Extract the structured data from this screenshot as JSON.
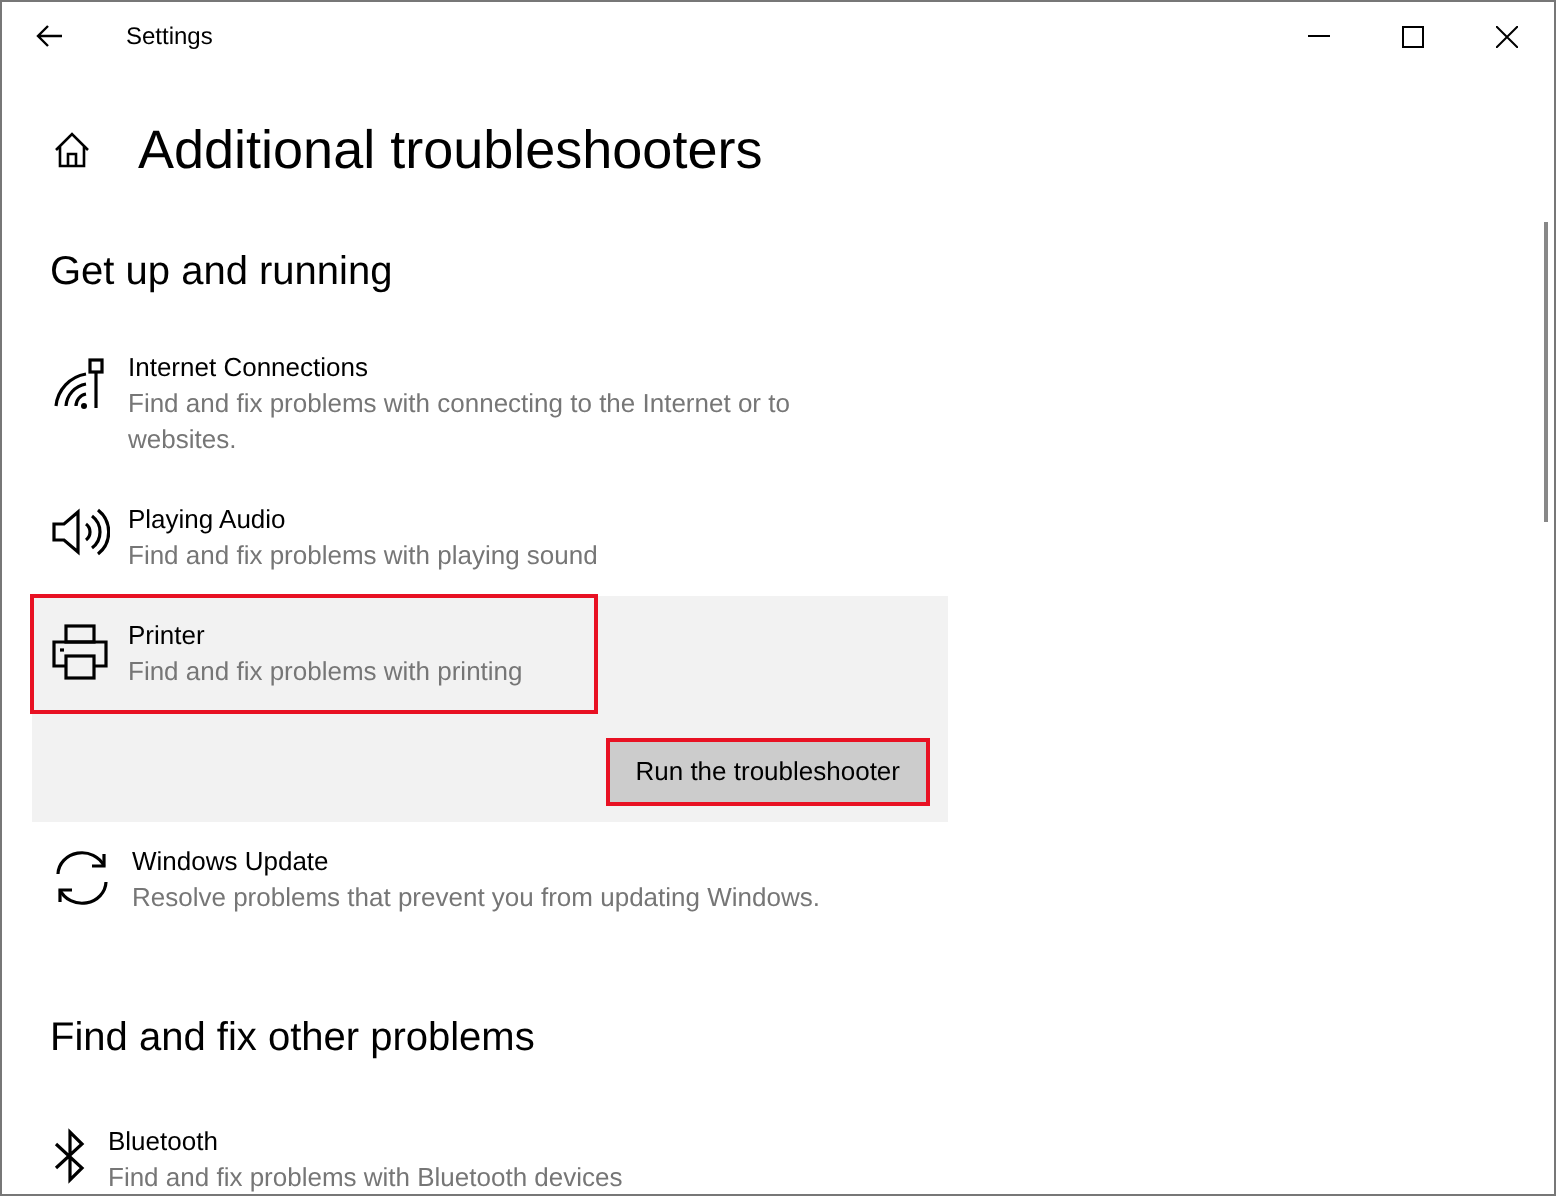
{
  "window": {
    "title": "Settings"
  },
  "page": {
    "title": "Additional troubleshooters"
  },
  "sections": [
    {
      "heading": "Get up and running",
      "items": [
        {
          "kind": "internet",
          "title": "Internet Connections",
          "description": "Find and fix problems with connecting to the Internet or to websites.",
          "selected": false,
          "highlighted": false
        },
        {
          "kind": "audio",
          "title": "Playing Audio",
          "description": "Find and fix problems with playing sound",
          "selected": false,
          "highlighted": false
        },
        {
          "kind": "printer",
          "title": "Printer",
          "description": "Find and fix problems with printing",
          "selected": true,
          "highlighted": true,
          "button": {
            "label": "Run the troubleshooter",
            "highlighted": true
          }
        },
        {
          "kind": "update",
          "title": "Windows Update",
          "description": "Resolve problems that prevent you from updating Windows.",
          "selected": false,
          "highlighted": false
        }
      ]
    },
    {
      "heading": "Find and fix other problems",
      "items": [
        {
          "kind": "bluetooth",
          "title": "Bluetooth",
          "description": "Find and fix problems with Bluetooth devices",
          "selected": false,
          "highlighted": false
        }
      ]
    }
  ]
}
